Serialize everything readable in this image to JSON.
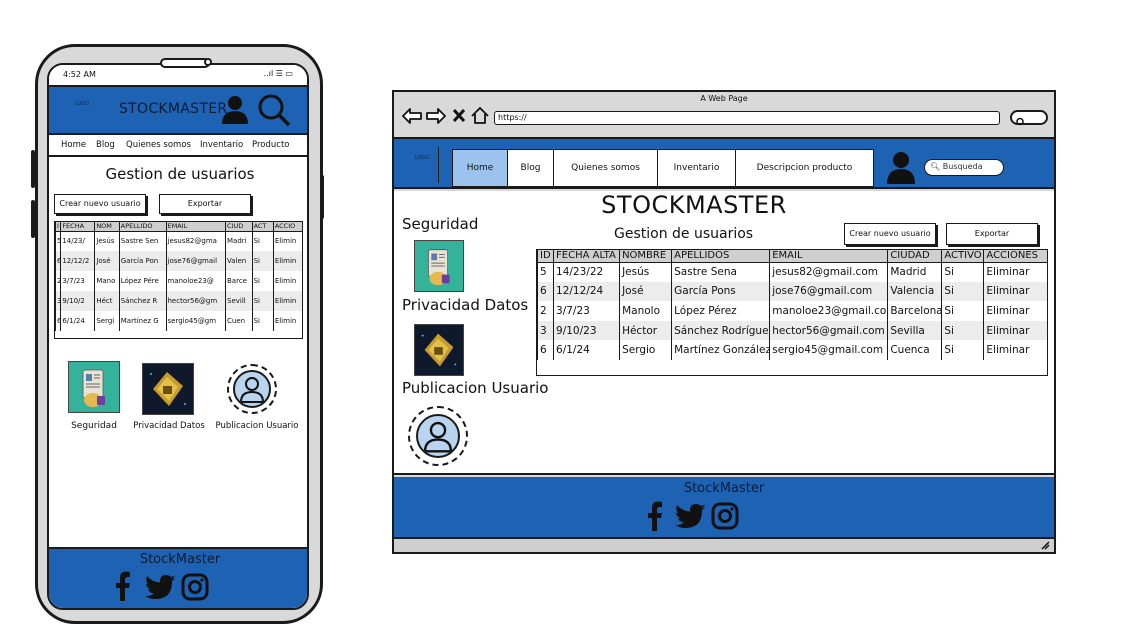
{
  "phone": {
    "status": {
      "time": "4:52 AM",
      "signals": "..ıl ☰ ▭"
    },
    "header": {
      "brand": "STOCKMASTER",
      "logo_text": "LOGO"
    },
    "nav": [
      "Home",
      "Blog",
      "Quienes somos",
      "Inventario",
      "Producto"
    ],
    "title": "Gestion de usuarios",
    "buttons": {
      "new_user": "Crear nuevo usuario",
      "export": "Exportar"
    },
    "table": {
      "headers": [
        "I",
        "FECHA",
        "NOM",
        "APELLIDO",
        "EMAIL",
        "CIUD",
        "ACT",
        "ACCIO"
      ],
      "rows": [
        [
          "5",
          "14/23/",
          "Jesús",
          "Sastre Sen",
          "jesus82@gma",
          "Madri",
          "Si",
          "Elimin"
        ],
        [
          "6",
          "12/12/2",
          "José",
          "García Pon",
          "jose76@gmail",
          "Valen",
          "Si",
          "Elimin"
        ],
        [
          "2",
          "3/7/23",
          "Mano",
          "López Pére",
          "manoloe23@",
          "Barce",
          "Si",
          "Elimin"
        ],
        [
          "3",
          "9/10/2",
          "Héct",
          "Sánchez R",
          "hector56@gm",
          "Sevill",
          "Si",
          "Elimin"
        ],
        [
          "6",
          "6/1/24",
          "Sergi",
          "Martínez G",
          "sergio45@gm",
          "Cuen",
          "Si",
          "Elimin"
        ]
      ]
    },
    "tiles": [
      "Seguridad",
      "Privacidad Datos",
      "Publicacion Usuario"
    ],
    "footer": {
      "brand": "StockMaster"
    }
  },
  "browser": {
    "window_title": "A Web Page",
    "url": "https://",
    "nav": [
      "Home",
      "Blog",
      "Quienes somos",
      "Inventario",
      "Descripcion producto"
    ],
    "active_nav": "Home",
    "search_placeholder": "Busqueda",
    "logo_text": "LOGO",
    "brand": "STOCKMASTER",
    "subtitle": "Gestion de usuarios",
    "buttons": {
      "new_user": "Crear nuevo usuario",
      "export": "Exportar"
    },
    "side_labels": [
      "Seguridad",
      "Privacidad Datos",
      "Publicacion Usuario"
    ],
    "table": {
      "headers": [
        "ID",
        "FECHA ALTA",
        "NOMBRE",
        "APELLIDOS",
        "EMAIL",
        "CIUDAD",
        "ACTIVO",
        "ACCIONES"
      ],
      "rows": [
        [
          "5",
          "14/23/22",
          "Jesús",
          "Sastre Sena",
          "jesus82@gmail.com",
          "Madrid",
          "Si",
          "Eliminar"
        ],
        [
          "6",
          "12/12/24",
          "José",
          "García Pons",
          "jose76@gmail.com",
          "Valencia",
          "Si",
          "Eliminar"
        ],
        [
          "2",
          "3/7/23",
          "Manolo",
          "López Pérez",
          "manoloe23@gmail.com",
          "Barcelona",
          "Si",
          "Eliminar"
        ],
        [
          "3",
          "9/10/23",
          "Héctor",
          "Sánchez Rodríguez",
          "hector56@gmail.com",
          "Sevilla",
          "Si",
          "Eliminar"
        ],
        [
          "6",
          "6/1/24",
          "Sergio",
          "Martínez González",
          "sergio45@gmail.com",
          "Cuenca",
          "Si",
          "Eliminar"
        ]
      ]
    },
    "footer": {
      "brand": "StockMaster"
    }
  },
  "colors": {
    "primary": "#1e63b3",
    "header_text": "#0a1a33",
    "chrome": "#d9d9d9"
  },
  "icons": [
    "back-arrow-icon",
    "forward-arrow-icon",
    "close-icon",
    "home-icon",
    "user-icon",
    "search-icon",
    "facebook-icon",
    "twitter-icon",
    "instagram-icon"
  ]
}
